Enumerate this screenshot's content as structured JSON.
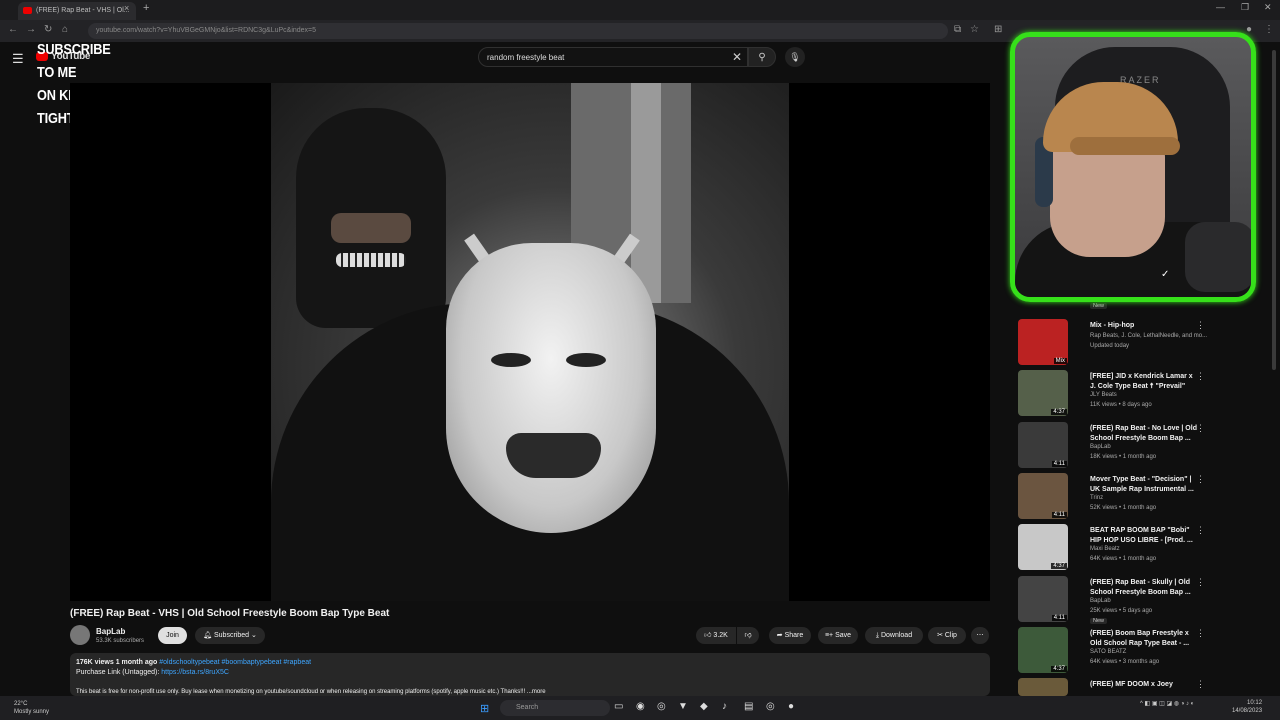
{
  "browser": {
    "tab_title": "(FREE) Rap Beat - VHS | Ol...",
    "url": "youtube.com/watch?v=YhuVBGeGMNjo&list=RDNC3g&LuPc&index=5",
    "new_tab": "+",
    "close": "×"
  },
  "overlay": {
    "lines": [
      "SUBSCRIBE",
      "TO ME",
      "ON KICK",
      "TIGHT CUNTS"
    ]
  },
  "youtube": {
    "logo_text": "YouTube",
    "search_value": "random freestyle beat",
    "video": {
      "title": "(FREE) Rap Beat - VHS | Old School Freestyle Boom Bap Type Beat",
      "channel": "BapLab",
      "subscribers": "53.3K subscribers",
      "join_label": "Join",
      "subscribed_label": "Subscribed",
      "likes": "3.2K",
      "share_label": "Share",
      "save_label": "Save",
      "download_label": "Download",
      "clip_label": "Clip",
      "more_label": "⋯",
      "views_date": "176K views  1 month ago",
      "tags": "#oldschooltypebeat #boombaptypebeat #rapbeat",
      "purchase_prefix": "Purchase Link (Untagged):",
      "purchase_link": "https://bsta.rs/8ruX5C",
      "description": "This beat is free for non-profit use only. Buy lease when monetizing on youtube/soundcloud or when releasing on streaming platforms (spotify, apple music etc.) Thanks!!! ...more"
    },
    "recommendations": [
      {
        "title": "Mix - Hip-hop",
        "channel": "Rap Beats, J. Cole, LethalNeedle, and mo...",
        "meta": "Updated today",
        "duration": "Mix",
        "badge": ""
      },
      {
        "title": "[FREE] JID x Kendrick Lamar x J. Cole Type Beat ☨ \"Prevail\"",
        "channel": "JLY Beats",
        "meta": "11K views • 8 days ago",
        "duration": "4:37",
        "badge": ""
      },
      {
        "title": "(FREE) Rap Beat - No Love | Old School Freestyle Boom Bap ...",
        "channel": "BapLab",
        "meta": "18K views • 1 month ago",
        "duration": "4:11",
        "badge": ""
      },
      {
        "title": "Mover Type Beat - \"Decision\" | UK Sample Rap Instrumental ...",
        "channel": "Trinz",
        "meta": "52K views • 1 month ago",
        "duration": "4:11",
        "badge": ""
      },
      {
        "title": "BEAT RAP BOOM BAP \"Bobi\" HIP HOP USO LIBRE - [Prod. ...",
        "channel": "Maxi Beatz",
        "meta": "64K views • 1 month ago",
        "duration": "4:37",
        "badge": ""
      },
      {
        "title": "(FREE) Rap Beat - Skully | Old School Freestyle Boom Bap ...",
        "channel": "BapLab",
        "meta": "25K views • 5 days ago",
        "duration": "4:11",
        "badge": "New"
      },
      {
        "title": "(FREE) Boom Bap Freestyle x Old School Rap Type Beat - ...",
        "channel": "SATO BEATZ",
        "meta": "64K views • 3 months ago",
        "duration": "4:37",
        "badge": ""
      },
      {
        "title": "(FREE) MF DOOM x Joey",
        "channel": "",
        "meta": "",
        "duration": "",
        "badge": ""
      }
    ],
    "top_new_badge": "New"
  },
  "webcam": {
    "chair_brand": "RAZER"
  },
  "taskbar": {
    "weather_temp": "22°C",
    "weather_desc": "Mostly sunny",
    "search_placeholder": "Search",
    "time": "10:12",
    "date": "14/08/2023"
  },
  "colors": {
    "webcam_border": "#36e01a",
    "youtube_red": "#e00000",
    "link_blue": "#3ea6ff"
  }
}
